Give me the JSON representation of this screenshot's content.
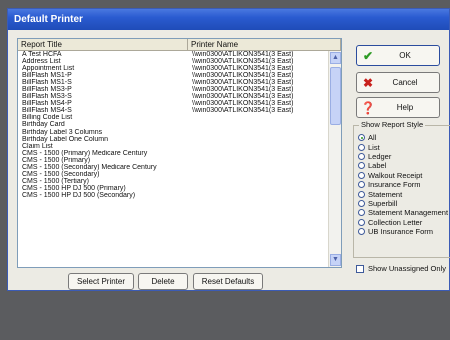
{
  "window": {
    "title": "Default Printer"
  },
  "list": {
    "headers": {
      "report_title": "Report Title",
      "printer_name": "Printer Name"
    },
    "rows": [
      {
        "title": "A Test HCFA",
        "printer": "\\\\win0300\\ATLIKON3541(3 East)"
      },
      {
        "title": "Address List",
        "printer": "\\\\win0300\\ATLIKON3541(3 East)"
      },
      {
        "title": "Appointment List",
        "printer": "\\\\win0300\\ATLIKON3541(3 East)"
      },
      {
        "title": "BillFlash MS1-P",
        "printer": "\\\\win0300\\ATLIKON3541(3 East)"
      },
      {
        "title": "BillFlash MS1-S",
        "printer": "\\\\win0300\\ATLIKON3541(3 East)"
      },
      {
        "title": "BillFlash MS3-P",
        "printer": "\\\\win0300\\ATLIKON3541(3 East)"
      },
      {
        "title": "BillFlash MS3-S",
        "printer": "\\\\win0300\\ATLIKON3541(3 East)"
      },
      {
        "title": "BillFlash MS4-P",
        "printer": "\\\\win0300\\ATLIKON3541(3 East)"
      },
      {
        "title": "BillFlash MS4-S",
        "printer": "\\\\win0300\\ATLIKON3541(3 East)"
      },
      {
        "title": "Billing Code List",
        "printer": ""
      },
      {
        "title": "Birthday Card",
        "printer": ""
      },
      {
        "title": "Birthday Label 3 Columns",
        "printer": ""
      },
      {
        "title": "Birthday Label One Column",
        "printer": ""
      },
      {
        "title": "Claim List",
        "printer": ""
      },
      {
        "title": "CMS - 1500 (Primary) Medicare Century",
        "printer": ""
      },
      {
        "title": "CMS - 1500 (Primary)",
        "printer": ""
      },
      {
        "title": "CMS - 1500 (Secondary) Medicare Century",
        "printer": ""
      },
      {
        "title": "CMS - 1500 (Secondary)",
        "printer": ""
      },
      {
        "title": "CMS - 1500 (Tertiary)",
        "printer": ""
      },
      {
        "title": "CMS - 1500 HP DJ 500 (Primary)",
        "printer": ""
      },
      {
        "title": "CMS - 1500 HP DJ 500 (Secondary)",
        "printer": ""
      }
    ]
  },
  "buttons": {
    "select_printer": "Select Printer",
    "delete": "Delete",
    "reset_defaults": "Reset Defaults",
    "ok": "OK",
    "cancel": "Cancel",
    "help": "Help"
  },
  "report_style": {
    "label": "Show Report Style",
    "options": [
      {
        "label": "All",
        "selected": true
      },
      {
        "label": "List",
        "selected": false
      },
      {
        "label": "Ledger",
        "selected": false
      },
      {
        "label": "Label",
        "selected": false
      },
      {
        "label": "Walkout Receipt",
        "selected": false
      },
      {
        "label": "Insurance Form",
        "selected": false
      },
      {
        "label": "Statement",
        "selected": false
      },
      {
        "label": "Superbill",
        "selected": false
      },
      {
        "label": "Statement Management",
        "selected": false
      },
      {
        "label": "Collection Letter",
        "selected": false
      },
      {
        "label": "UB Insurance Form",
        "selected": false
      }
    ]
  },
  "show_unassigned": {
    "label": "Show Unassigned Only",
    "checked": false
  },
  "icons": {
    "ok": "checkmark-icon",
    "cancel": "x-icon",
    "help": "help-book-icon"
  },
  "colors": {
    "titlebar": "#2a5bd0",
    "ok_icon": "#2d9a24",
    "cancel_icon": "#c8201c"
  }
}
